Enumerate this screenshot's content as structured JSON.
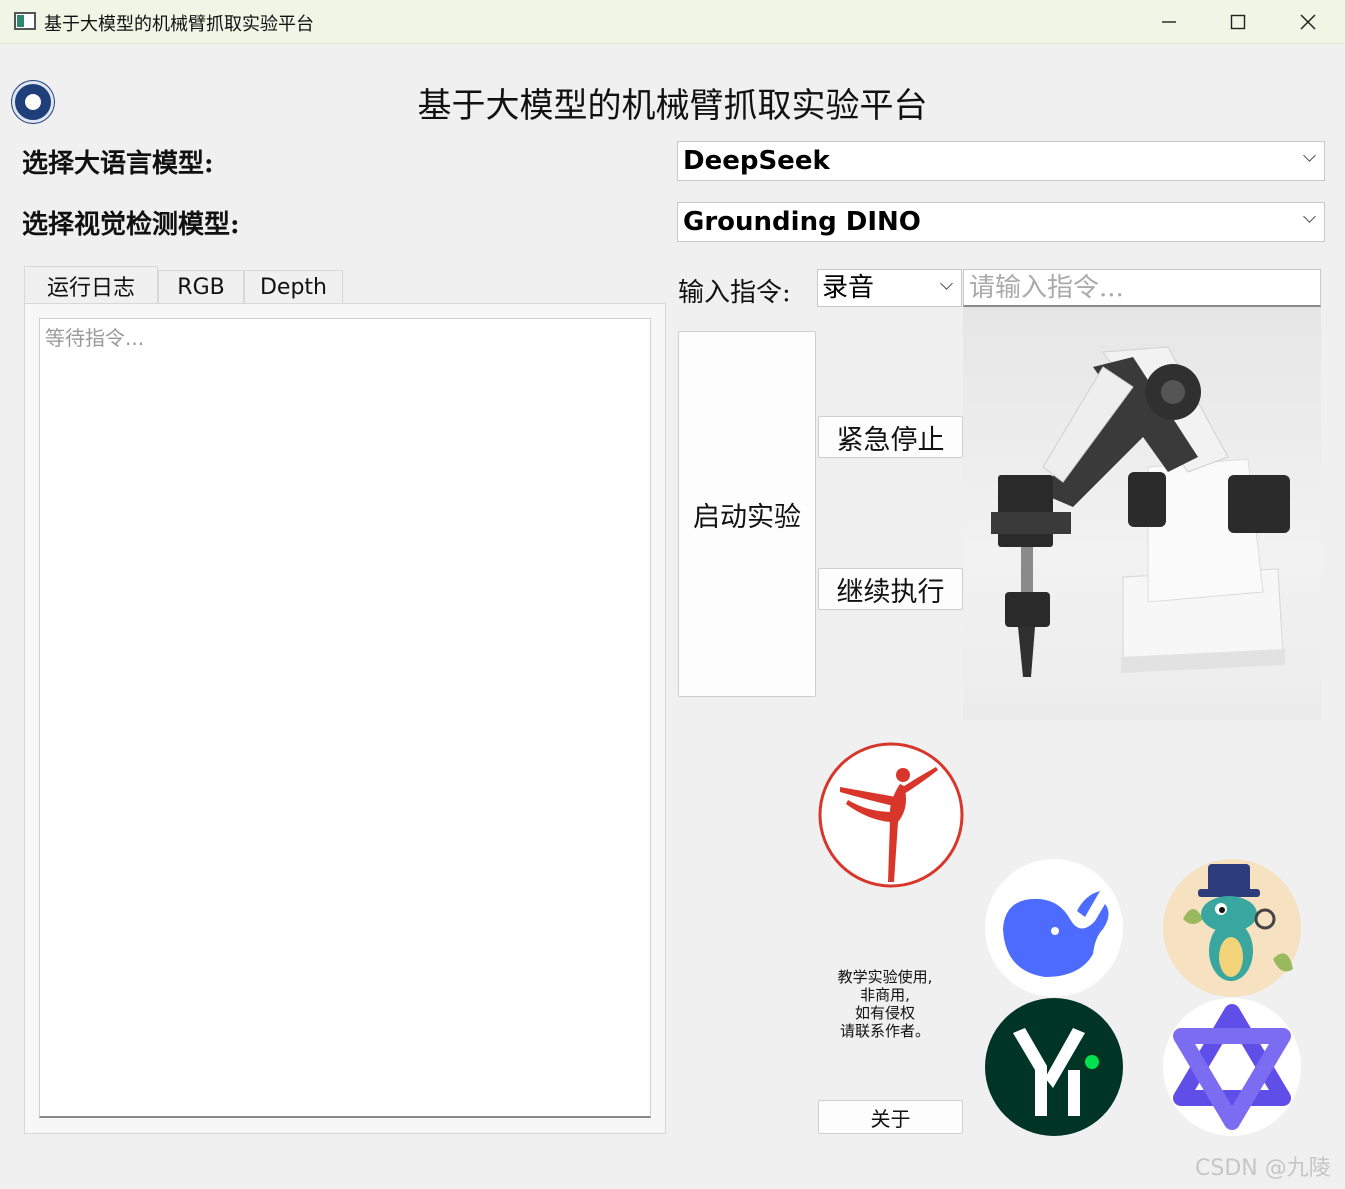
{
  "window": {
    "title": "基于大模型的机械臂抓取实验平台",
    "minimize_glyph": "─",
    "maximize_glyph": "☐",
    "close_glyph": "✕"
  },
  "header": {
    "title": "基于大模型的机械臂抓取实验平台",
    "logo_icon": "university-seal-icon"
  },
  "llm": {
    "label": "选择大语言模型:",
    "selected": "DeepSeek"
  },
  "vision": {
    "label": "选择视觉检测模型:",
    "selected": "Grounding DINO"
  },
  "tabs": [
    {
      "label": "运行日志"
    },
    {
      "label": "RGB"
    },
    {
      "label": "Depth"
    }
  ],
  "log": {
    "placeholder": "等待指令..."
  },
  "command": {
    "label": "输入指令:",
    "mode": "录音",
    "placeholder": "请输入指令..."
  },
  "buttons": {
    "start": "启动实验",
    "stop": "紧急停止",
    "continue": "继续执行",
    "about": "关于"
  },
  "note": {
    "line1": "教学实验使用,",
    "line2": "非商用,",
    "line3": "如有侵权",
    "line4": "请联系作者。"
  },
  "watermark": "CSDN @九陵",
  "colors": {
    "titlebar": "#f0f6e6",
    "background": "#f0f0f0",
    "ballet_red": "#d8362b",
    "deepseek_blue": "#4d6bfe",
    "yi_green": "#003425",
    "qwen_purple": "#5f4ee8"
  }
}
